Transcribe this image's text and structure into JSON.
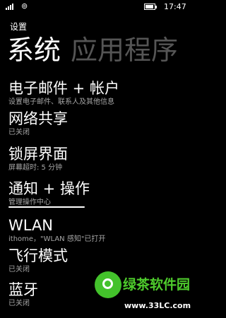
{
  "status_bar": {
    "time": "17:47",
    "wifi": "⊚"
  },
  "app_title": "设置",
  "pivot": {
    "active": "系统",
    "inactive": "应用程序"
  },
  "items": [
    {
      "title": "电子邮件 + 帐户",
      "subtitle": "设置电子邮件、联系人及其他信息"
    },
    {
      "title": "网络共享",
      "subtitle": "已关闭"
    },
    {
      "title": "锁屏界面",
      "subtitle": "屏幕超时: 5 分钟"
    },
    {
      "title": "通知 + 操作",
      "subtitle": "管理操作中心"
    },
    {
      "title": "WLAN",
      "subtitle": "ithome，\"WLAN 感知\"已打开"
    },
    {
      "title": "飞行模式",
      "subtitle": "已关闭"
    },
    {
      "title": "蓝牙",
      "subtitle": "已关闭"
    }
  ],
  "watermark": {
    "name": "绿茶软件园",
    "url": "www.33LC.com"
  },
  "colors": {
    "background": "#000000",
    "subtitle": "#a6a6a6",
    "inactive_pivot": "#555555",
    "watermark_green": "#4ecb2c"
  }
}
